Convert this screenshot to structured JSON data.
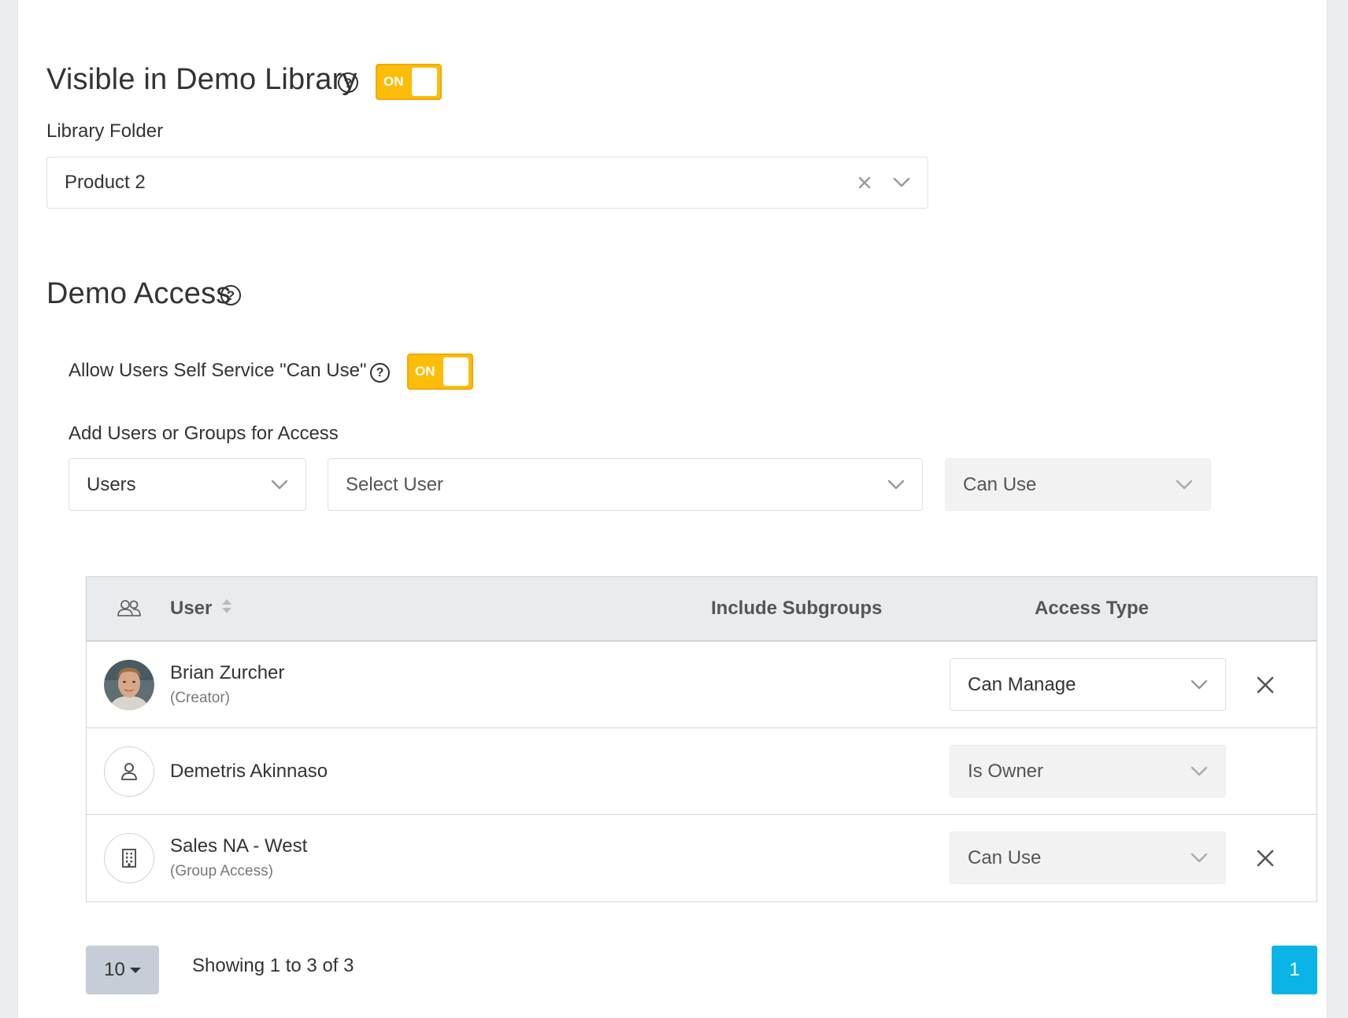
{
  "library": {
    "visible_title": "Visible in Demo Library",
    "visible_toggle": "ON",
    "folder_label": "Library Folder",
    "folder_value": "Product 2"
  },
  "access": {
    "title": "Demo Access",
    "self_service_label": "Allow Users Self Service \"Can Use\"",
    "self_service_toggle": "ON",
    "add_label": "Add Users or Groups for Access",
    "type_select": "Users",
    "user_select_placeholder": "Select User",
    "access_select": "Can Use"
  },
  "table": {
    "headers": {
      "user": "User",
      "include_subgroups": "Include Subgroups",
      "access_type": "Access Type"
    },
    "rows": [
      {
        "name": "Brian Zurcher",
        "sub": "(Creator)",
        "access": "Can Manage",
        "icon": "photo-avatar",
        "removable": true
      },
      {
        "name": "Demetris Akinnaso",
        "sub": "",
        "access": "Is Owner",
        "icon": "user-icon",
        "removable": false
      },
      {
        "name": "Sales NA - West",
        "sub": "(Group Access)",
        "access": "Can Use",
        "icon": "building-icon",
        "removable": true
      }
    ]
  },
  "footer": {
    "page_size": "10",
    "showing": "Showing 1 to 3 of 3",
    "current_page": "1"
  },
  "colors": {
    "toggle": "#fbbd08",
    "header_bg": "#e9ecef",
    "page_active": "#0ab4e6"
  }
}
